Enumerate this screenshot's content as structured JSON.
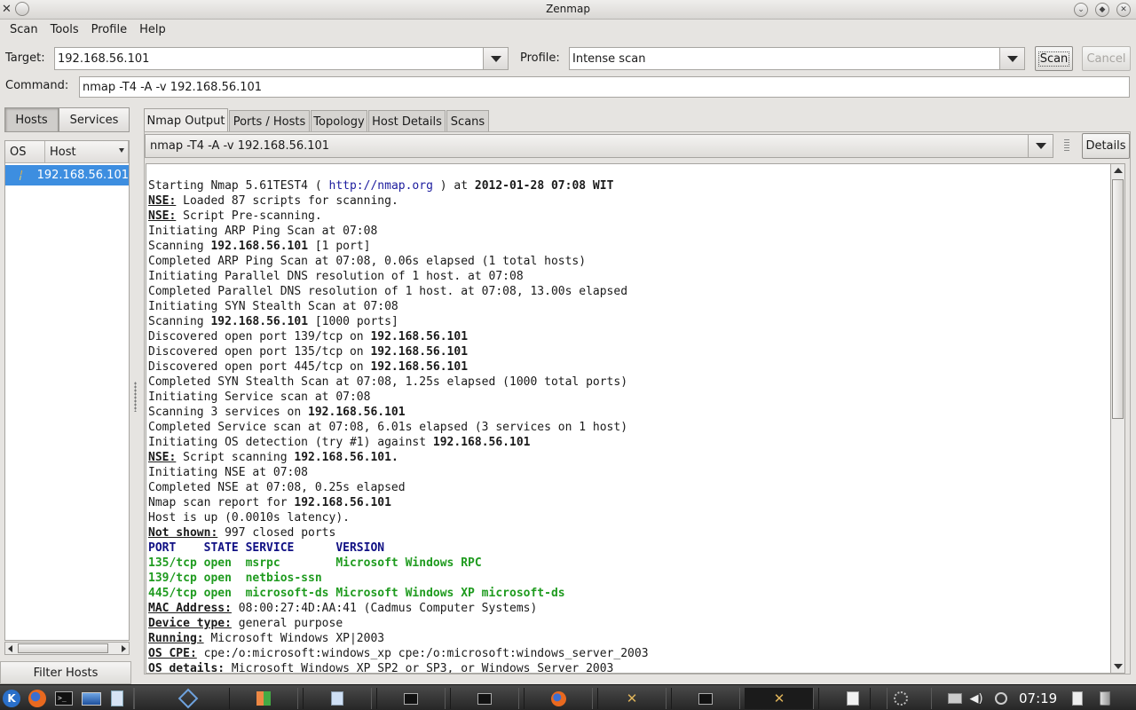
{
  "window": {
    "title": "Zenmap"
  },
  "menu": [
    "Scan",
    "Tools",
    "Profile",
    "Help"
  ],
  "toolbar": {
    "target_label": "Target:",
    "target_value": "192.168.56.101",
    "profile_label": "Profile:",
    "profile_value": "Intense scan",
    "scan_button": "Scan",
    "cancel_button": "Cancel",
    "command_label": "Command:",
    "command_value": "nmap -T4 -A -v 192.168.56.101"
  },
  "sidebar": {
    "hosts_button": "Hosts",
    "services_button": "Services",
    "columns": [
      "OS",
      "Host"
    ],
    "hosts": [
      {
        "name": "192.168.56.101"
      }
    ],
    "filter_button": "Filter Hosts"
  },
  "tabs": [
    "Nmap Output",
    "Ports / Hosts",
    "Topology",
    "Host Details",
    "Scans"
  ],
  "output_selector": {
    "value": "nmap -T4 -A -v 192.168.56.101",
    "details_button": "Details"
  },
  "output": [
    [
      {
        "t": "Starting Nmap 5.61TEST4 ( "
      },
      {
        "t": "http://nmap.org",
        "s": "blue"
      },
      {
        "t": " ) at "
      },
      {
        "t": "2012-01-28 07:08 WIT",
        "s": "b"
      }
    ],
    [
      {
        "t": "NSE:",
        "s": "u"
      },
      {
        "t": " Loaded 87 scripts for scanning."
      }
    ],
    [
      {
        "t": "NSE:",
        "s": "u"
      },
      {
        "t": " Script Pre-scanning."
      }
    ],
    [
      {
        "t": "Initiating ARP Ping Scan at 07:08"
      }
    ],
    [
      {
        "t": "Scanning "
      },
      {
        "t": "192.168.56.101",
        "s": "b"
      },
      {
        "t": " [1 port]"
      }
    ],
    [
      {
        "t": "Completed ARP Ping Scan at 07:08, 0.06s elapsed (1 total hosts)"
      }
    ],
    [
      {
        "t": "Initiating Parallel DNS resolution of 1 host. at 07:08"
      }
    ],
    [
      {
        "t": "Completed Parallel DNS resolution of 1 host. at 07:08, 13.00s elapsed"
      }
    ],
    [
      {
        "t": "Initiating SYN Stealth Scan at 07:08"
      }
    ],
    [
      {
        "t": "Scanning "
      },
      {
        "t": "192.168.56.101",
        "s": "b"
      },
      {
        "t": " [1000 ports]"
      }
    ],
    [
      {
        "t": "Discovered open port 139/tcp on "
      },
      {
        "t": "192.168.56.101",
        "s": "b"
      }
    ],
    [
      {
        "t": "Discovered open port 135/tcp on "
      },
      {
        "t": "192.168.56.101",
        "s": "b"
      }
    ],
    [
      {
        "t": "Discovered open port 445/tcp on "
      },
      {
        "t": "192.168.56.101",
        "s": "b"
      }
    ],
    [
      {
        "t": "Completed SYN Stealth Scan at 07:08, 1.25s elapsed (1000 total ports)"
      }
    ],
    [
      {
        "t": "Initiating Service scan at 07:08"
      }
    ],
    [
      {
        "t": "Scanning 3 services on "
      },
      {
        "t": "192.168.56.101",
        "s": "b"
      }
    ],
    [
      {
        "t": "Completed Service scan at 07:08, 6.01s elapsed (3 services on 1 host)"
      }
    ],
    [
      {
        "t": "Initiating OS detection (try #1) against "
      },
      {
        "t": "192.168.56.101",
        "s": "b"
      }
    ],
    [
      {
        "t": "NSE:",
        "s": "u"
      },
      {
        "t": " Script scanning "
      },
      {
        "t": "192.168.56.101.",
        "s": "b"
      }
    ],
    [
      {
        "t": "Initiating NSE at 07:08"
      }
    ],
    [
      {
        "t": "Completed NSE at 07:08, 0.25s elapsed"
      }
    ],
    [
      {
        "t": "Nmap scan report for "
      },
      {
        "t": "192.168.56.101",
        "s": "b"
      }
    ],
    [
      {
        "t": "Host is up (0.0010s latency)."
      }
    ],
    [
      {
        "t": "Not shown:",
        "s": "u"
      },
      {
        "t": " 997 closed ports"
      }
    ],
    [
      {
        "t": "PORT    STATE SERVICE      VERSION",
        "s": "navyb"
      }
    ],
    [
      {
        "t": "135/tcp open  msrpc        Microsoft Windows RPC",
        "s": "greenb"
      }
    ],
    [
      {
        "t": "139/tcp open  netbios-ssn",
        "s": "greenb"
      }
    ],
    [
      {
        "t": "445/tcp open  microsoft-ds Microsoft Windows XP microsoft-ds",
        "s": "greenb"
      }
    ],
    [
      {
        "t": "MAC Address:",
        "s": "u"
      },
      {
        "t": " 08:00:27:4D:AA:41 (Cadmus Computer Systems)"
      }
    ],
    [
      {
        "t": "Device type:",
        "s": "u"
      },
      {
        "t": " general purpose"
      }
    ],
    [
      {
        "t": "Running:",
        "s": "u"
      },
      {
        "t": " Microsoft Windows XP|2003"
      }
    ],
    [
      {
        "t": "OS CPE:",
        "s": "u"
      },
      {
        "t": " cpe:/o:microsoft:windows_xp cpe:/o:microsoft:windows_server_2003"
      }
    ],
    [
      {
        "t": "OS details:",
        "s": "u"
      },
      {
        "t": " Microsoft Windows XP SP2 or SP3, or Windows Server 2003"
      }
    ]
  ],
  "taskbar": {
    "clock": "07:19",
    "launchers": [
      "kde-menu-icon",
      "firefox-icon",
      "terminal-icon",
      "monitor-icon",
      "files-icon",
      "virtualbox-icon",
      "paint-icon",
      "document-icon"
    ],
    "windows": [
      "terminal-icon",
      "terminal-icon",
      "firefox-icon",
      "zenmap-icon",
      "terminal-icon",
      "zenmap-icon",
      "editor-icon",
      "loading-icon"
    ],
    "tray": [
      "network-icon",
      "volume-icon",
      "power-icon",
      "clipboard-icon",
      "trash-icon"
    ]
  },
  "colors": {
    "selection": "#3d8ee0",
    "link": "#1c1c9e",
    "port_header": "#101084",
    "open_port": "#1f9b1f"
  }
}
